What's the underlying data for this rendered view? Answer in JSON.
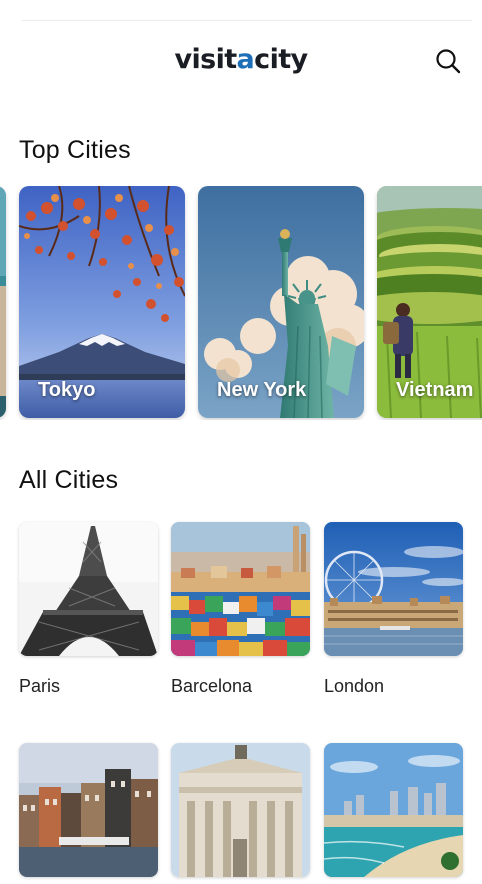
{
  "header": {
    "logo_part1": "visit",
    "logo_accent": "a",
    "logo_part2": "city",
    "search_icon": "search-icon"
  },
  "top_cities": {
    "title": "Top Cities",
    "items": [
      {
        "label": ""
      },
      {
        "label": "Tokyo"
      },
      {
        "label": "New York"
      },
      {
        "label": "Vietnam"
      }
    ]
  },
  "all_cities": {
    "title": "All Cities",
    "items": [
      {
        "label": "Paris"
      },
      {
        "label": "Barcelona"
      },
      {
        "label": "London"
      },
      {
        "label": ""
      },
      {
        "label": ""
      },
      {
        "label": ""
      }
    ]
  },
  "colors": {
    "logo_accent": "#1d6fb8",
    "logo_text": "#1a1d24"
  }
}
